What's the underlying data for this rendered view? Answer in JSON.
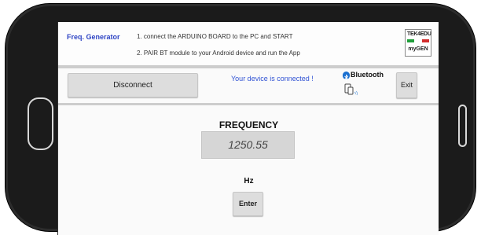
{
  "header": {
    "app_title": "Freq. Generator",
    "instructions": [
      "1. connect the ARDUINO BOARD to the PC and START",
      "2. PAIR BT module to your Android device and run the App"
    ],
    "logo": {
      "top_text": "TEK4EDU",
      "bottom_text": "myGEN",
      "flag_colors": [
        "#1f9e3a",
        "#ffffff",
        "#d22d2d"
      ]
    }
  },
  "toolbar": {
    "disconnect_label": "Disconnect",
    "status_text": "Your device is connected !",
    "bluetooth_label": "Bluetooth",
    "exit_label": "Exit"
  },
  "main": {
    "frequency_label": "FREQUENCY",
    "frequency_value": "1250.55",
    "unit_label": "Hz",
    "enter_label": "Enter"
  },
  "colors": {
    "accent_blue": "#2f45c4",
    "status_blue": "#3153d4",
    "button_gray": "#dddddd",
    "phone_body": "#1b1b1b"
  },
  "icons": [
    "bluetooth-icon",
    "device-icon",
    "home-button-icon"
  ]
}
